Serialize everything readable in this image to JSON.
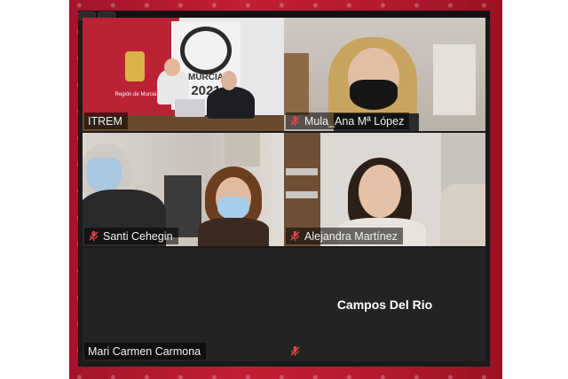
{
  "participants": [
    {
      "name": "ITREM",
      "muted": false,
      "active_speaker": true,
      "video": true
    },
    {
      "name": "Mula_Ana Mª López",
      "muted": true,
      "active_speaker": false,
      "video": true
    },
    {
      "name": "Santi Cehegin",
      "muted": true,
      "active_speaker": false,
      "video": true
    },
    {
      "name": "Alejandra Martínez",
      "muted": true,
      "active_speaker": false,
      "video": true
    },
    {
      "name": "Mari Carmen Carmona",
      "muted": false,
      "active_speaker": false,
      "video": false
    },
    {
      "name": "Campos Del Rio",
      "muted": true,
      "active_speaker": false,
      "video": false
    }
  ],
  "banner": {
    "brand_text": "MURCIA",
    "year_text": "2021",
    "region_text": "Región de Murcia"
  },
  "colors": {
    "active_border": "#d6e64a",
    "muted_icon": "#e0434b",
    "window_bg": "#1a1a1a"
  }
}
